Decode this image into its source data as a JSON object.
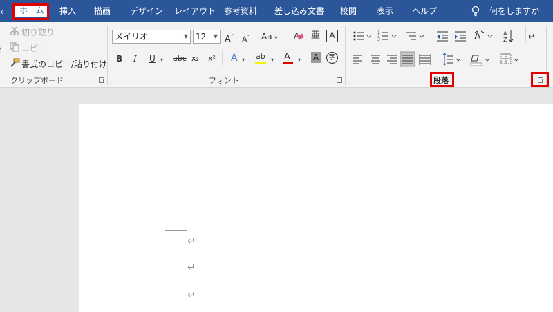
{
  "tabs": [
    {
      "label": "ホーム",
      "active": true
    },
    {
      "label": "挿入"
    },
    {
      "label": "描画"
    },
    {
      "label": "デザイン"
    },
    {
      "label": "レイアウト"
    },
    {
      "label": "参考資料"
    },
    {
      "label": "差し込み文書"
    },
    {
      "label": "校閲"
    },
    {
      "label": "表示"
    },
    {
      "label": "ヘルプ"
    }
  ],
  "tell_me": "何をしますか",
  "clipboard": {
    "cut": "切り取り",
    "copy": "コピー",
    "format_painter": "書式のコピー/貼り付け",
    "label": "クリップボード"
  },
  "font": {
    "name": "メイリオ",
    "size": "12",
    "label": "フォント",
    "case_btn": "Aa",
    "bold": "B",
    "italic": "I",
    "underline": "U",
    "strike": "abc",
    "subscript": "x₂",
    "superscript": "x²",
    "phonetic": "亜",
    "enclose": "字",
    "border": "A",
    "effects": "A",
    "highlight": "ab",
    "color": "A",
    "shading": "A",
    "grow": "A",
    "shrink": "A"
  },
  "paragraph": {
    "label": "段落"
  },
  "document": {
    "marks": [
      "↵",
      "↵",
      "↵"
    ]
  },
  "colors": {
    "accent": "#2b579a",
    "highlight": "#e00000"
  }
}
